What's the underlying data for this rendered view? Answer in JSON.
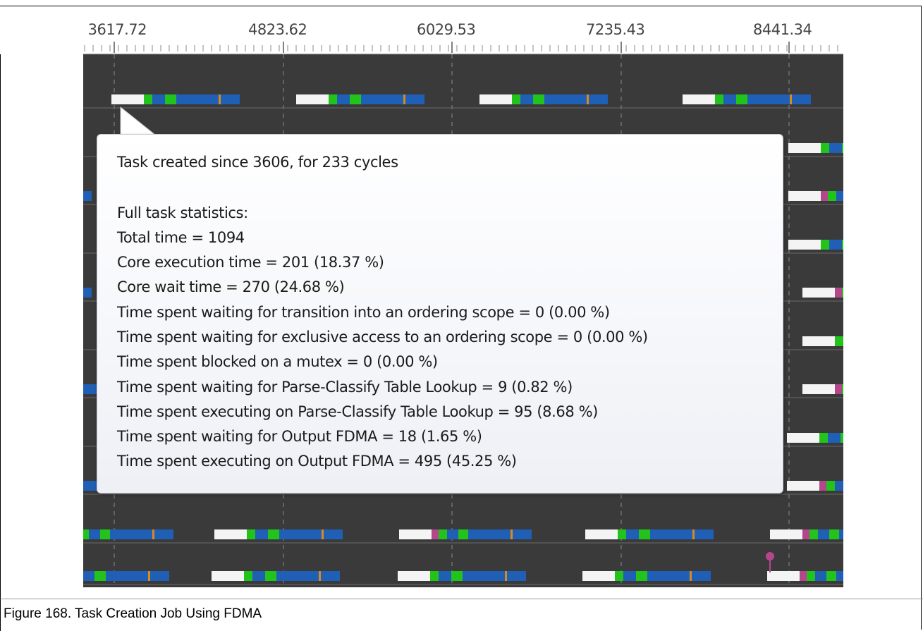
{
  "ruler": {
    "labels": [
      "3617.72",
      "4823.62",
      "6029.53",
      "7235.43",
      "8441.34"
    ]
  },
  "tooltip": {
    "title": "Task created since 3606, for 233 cycles",
    "lines": [
      "Full task statistics:",
      "Total time = 1094",
      "Core execution time = 201 (18.37 %)",
      "Core wait time = 270 (24.68 %)",
      "Time spent waiting for transition into an ordering scope = 0 (0.00 %)",
      "Time spent waiting for exclusive access to an ordering scope = 0 (0.00 %)",
      "Time spent blocked on a mutex = 0 (0.00 %)",
      "Time spent waiting for Parse-Classify Table Lookup = 9 (0.82 %)",
      "Time spent executing on Parse-Classify Table Lookup = 95 (8.68 %)",
      "Time spent waiting for Output FDMA = 18 (1.65 %)",
      "Time spent executing on Output FDMA = 495 (45.25 %)"
    ]
  },
  "caption": "Figure 168. Task Creation Job Using FDMA",
  "colors": {
    "track_bg": "#3a3a3a",
    "task_white": "#f4f4f4",
    "task_green": "#22c41c",
    "task_blue": "#1f5fb5",
    "task_magenta": "#b4478c",
    "task_orange": "#d98a1e",
    "row_line": "#6a6a6a",
    "grid_dash": "#8a8a8a"
  }
}
